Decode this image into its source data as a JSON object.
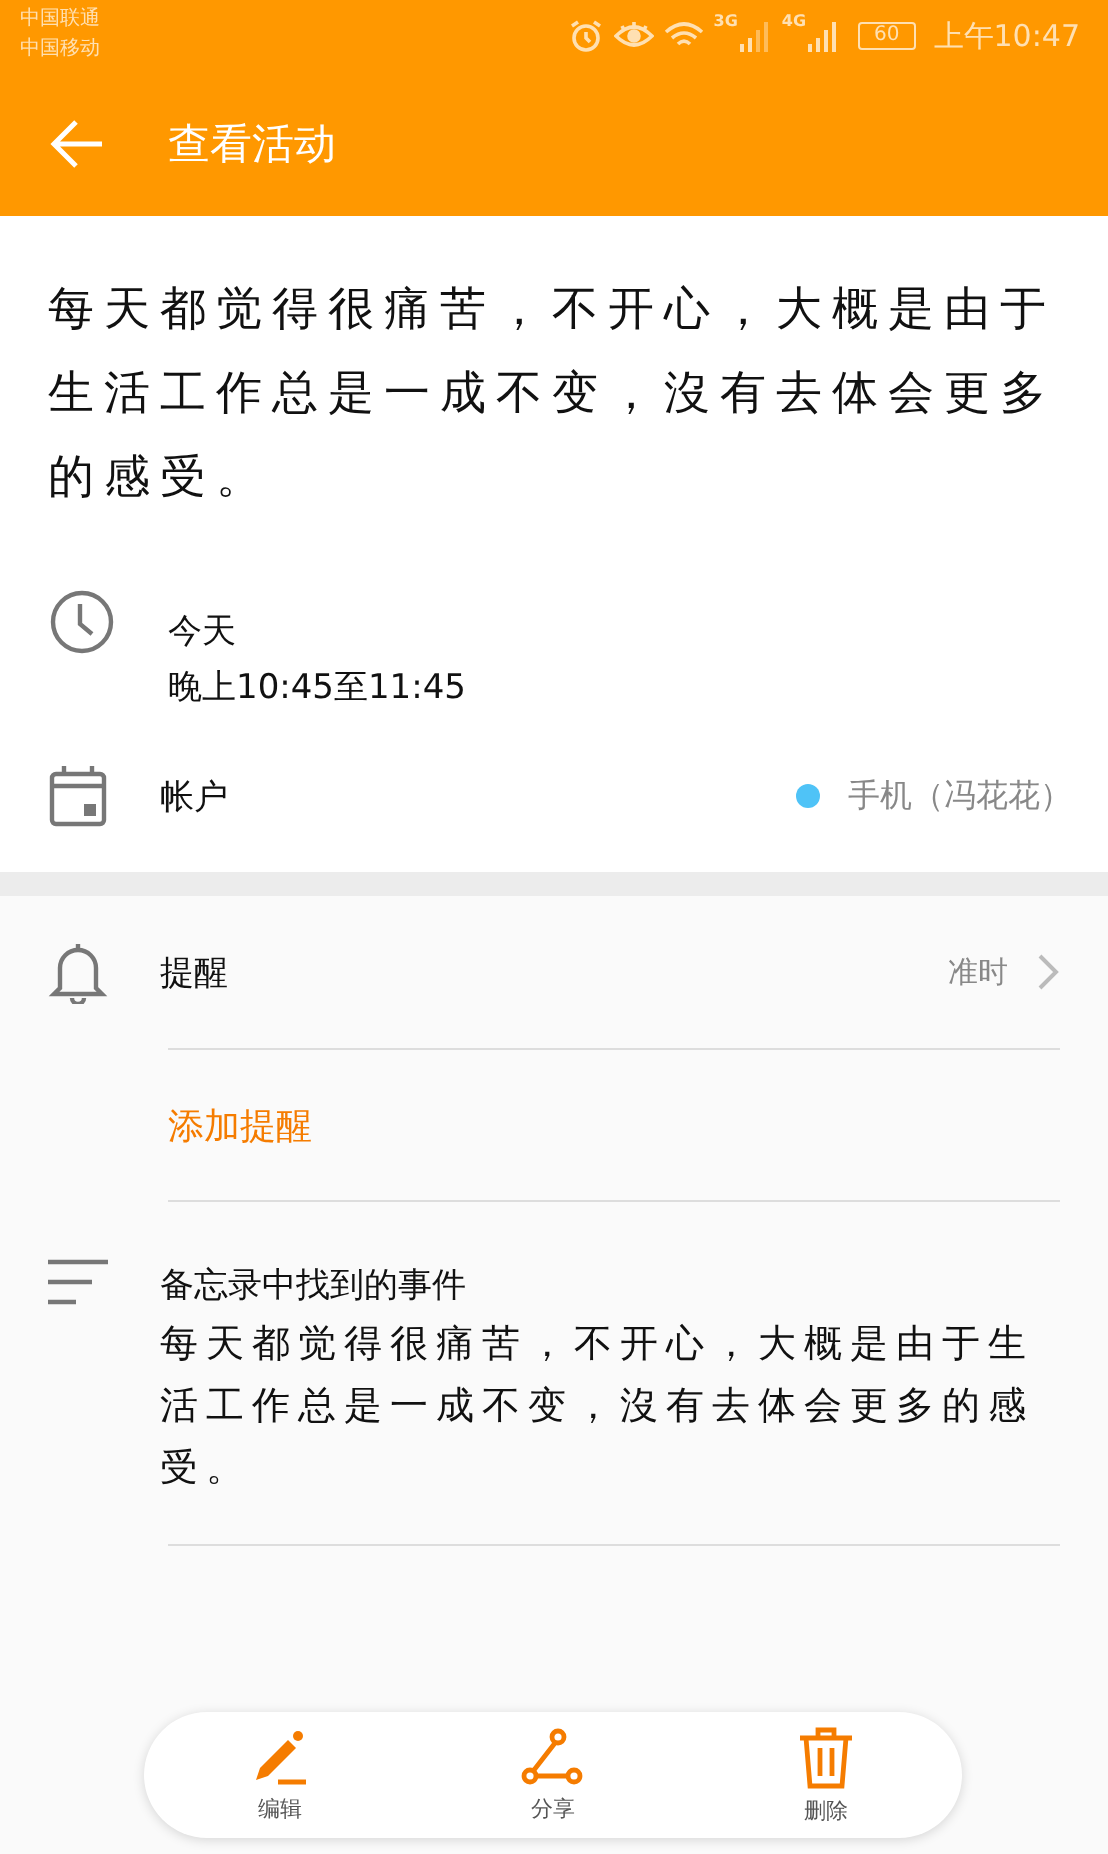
{
  "status_bar": {
    "carriers": [
      "中国联通",
      "中国移动"
    ],
    "network_labels": [
      "3G",
      "4G"
    ],
    "battery": "60",
    "time": "上午10:47"
  },
  "header": {
    "title": "查看活动"
  },
  "description": "每天都觉得很痛苦，不开心，大概是由于生活工作总是一成不变，沒有去体会更多的感受。",
  "time": {
    "day": "今天",
    "range": "晚上10:45至11:45"
  },
  "account": {
    "label": "帐户",
    "value": "手机（冯花花）",
    "color": "#4fc3f7"
  },
  "reminder": {
    "label": "提醒",
    "value": "准时",
    "add_label": "添加提醒"
  },
  "note": {
    "title": "备忘录中找到的事件",
    "body": "每天都觉得很痛苦，不开心，大概是由于生活工作总是一成不变，沒有去体会更多的感受。"
  },
  "actions": [
    {
      "kind": "edit",
      "label": "编辑"
    },
    {
      "kind": "share",
      "label": "分享"
    },
    {
      "kind": "delete",
      "label": "删除"
    }
  ]
}
